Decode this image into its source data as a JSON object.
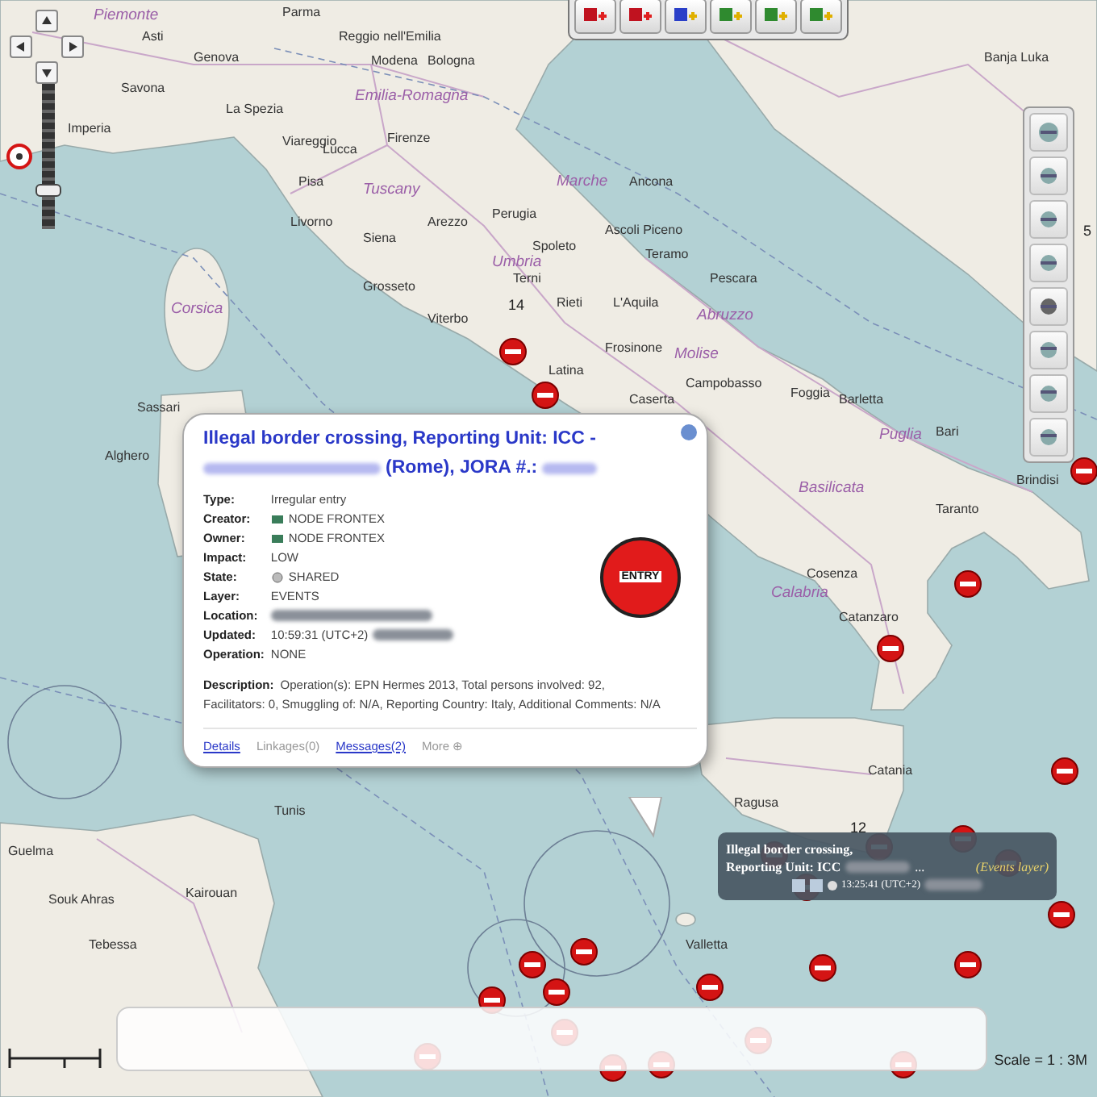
{
  "map": {
    "places": [
      {
        "name": "Piemonte",
        "kind": "region"
      },
      {
        "name": "Asti",
        "kind": "city"
      },
      {
        "name": "Savona",
        "kind": "city"
      },
      {
        "name": "Imperia",
        "kind": "city"
      },
      {
        "name": "Genova",
        "kind": "city"
      },
      {
        "name": "Parma",
        "kind": "city"
      },
      {
        "name": "Reggio nell'Emilia",
        "kind": "city"
      },
      {
        "name": "Modena",
        "kind": "city"
      },
      {
        "name": "Bologna",
        "kind": "city"
      },
      {
        "name": "Emilia-Romagna",
        "kind": "region"
      },
      {
        "name": "La Spezia",
        "kind": "city"
      },
      {
        "name": "Viareggio",
        "kind": "city"
      },
      {
        "name": "Lucca",
        "kind": "city"
      },
      {
        "name": "Firenze",
        "kind": "city"
      },
      {
        "name": "Pisa",
        "kind": "city"
      },
      {
        "name": "Livorno",
        "kind": "city"
      },
      {
        "name": "Tuscany",
        "kind": "region"
      },
      {
        "name": "Siena",
        "kind": "city"
      },
      {
        "name": "Arezzo",
        "kind": "city"
      },
      {
        "name": "Perugia",
        "kind": "city"
      },
      {
        "name": "Umbria",
        "kind": "region"
      },
      {
        "name": "Marche",
        "kind": "region"
      },
      {
        "name": "Ancona",
        "kind": "city"
      },
      {
        "name": "Grosseto",
        "kind": "city"
      },
      {
        "name": "Spoleto",
        "kind": "city"
      },
      {
        "name": "Ascoli Piceno",
        "kind": "city"
      },
      {
        "name": "Teramo",
        "kind": "city"
      },
      {
        "name": "Terni",
        "kind": "city"
      },
      {
        "name": "Viterbo",
        "kind": "city"
      },
      {
        "name": "Rieti",
        "kind": "city"
      },
      {
        "name": "L'Aquila",
        "kind": "city"
      },
      {
        "name": "Pescara",
        "kind": "city"
      },
      {
        "name": "Abruzzo",
        "kind": "region"
      },
      {
        "name": "Corsica",
        "kind": "region"
      },
      {
        "name": "Latina",
        "kind": "city"
      },
      {
        "name": "Frosinone",
        "kind": "city"
      },
      {
        "name": "Molise",
        "kind": "region"
      },
      {
        "name": "Campobasso",
        "kind": "city"
      },
      {
        "name": "Foggia",
        "kind": "city"
      },
      {
        "name": "Barletta",
        "kind": "city"
      },
      {
        "name": "Bari",
        "kind": "city"
      },
      {
        "name": "Puglia",
        "kind": "region"
      },
      {
        "name": "Caserta",
        "kind": "city"
      },
      {
        "name": "Taranto",
        "kind": "city"
      },
      {
        "name": "Brindisi",
        "kind": "city"
      },
      {
        "name": "Sassari",
        "kind": "city"
      },
      {
        "name": "Alghero",
        "kind": "city"
      },
      {
        "name": "Basilicata",
        "kind": "region"
      },
      {
        "name": "Cosenza",
        "kind": "city"
      },
      {
        "name": "Calabria",
        "kind": "region"
      },
      {
        "name": "Catanzaro",
        "kind": "city"
      },
      {
        "name": "Catania",
        "kind": "city"
      },
      {
        "name": "Ragusa",
        "kind": "city"
      },
      {
        "name": "Valletta",
        "kind": "city"
      },
      {
        "name": "Tunis",
        "kind": "city"
      },
      {
        "name": "Guelma",
        "kind": "city"
      },
      {
        "name": "Souk Ahras",
        "kind": "city"
      },
      {
        "name": "Kairouan",
        "kind": "city"
      },
      {
        "name": "Tebessa",
        "kind": "city"
      },
      {
        "name": "Banja Luka",
        "kind": "city"
      }
    ],
    "clusters": [
      {
        "count": "14"
      },
      {
        "count": "12"
      },
      {
        "count": "5"
      }
    ],
    "scale": "Scale = 1 : 3M"
  },
  "popup": {
    "title": [
      {
        "kind": "text",
        "text": "Illegal border crossing, Reporting Unit: ICC -"
      },
      {
        "kind": "redacted"
      },
      {
        "kind": "text",
        "text": "(Rome), JORA #.:"
      },
      {
        "kind": "redacted"
      }
    ],
    "fields": [
      {
        "label": "Type:",
        "kind": "text",
        "value": "Irregular entry"
      },
      {
        "label": "Creator:",
        "kind": "person",
        "value": "NODE FRONTEX"
      },
      {
        "label": "Owner:",
        "kind": "person",
        "value": "NODE FRONTEX"
      },
      {
        "label": "Impact:",
        "kind": "text",
        "value": "LOW"
      },
      {
        "label": "State:",
        "kind": "shared",
        "value": "SHARED"
      },
      {
        "label": "Layer:",
        "kind": "text",
        "value": "EVENTS"
      },
      {
        "label": "Location:",
        "kind": "redacted"
      },
      {
        "label": "Updated:",
        "kind": "text-redacted",
        "value": "10:59:31 (UTC+2)"
      },
      {
        "label": "Operation:",
        "kind": "text",
        "value": "NONE"
      }
    ],
    "badge": "ENTRY",
    "description_label": "Description:",
    "description": "Operation(s): EPN Hermes 2013, Total persons involved: 92, Facilitators: 0, Smuggling of: N/A, Reporting Country: Italy, Additional Comments: N/A",
    "links": [
      {
        "label": "Details",
        "disabled": false
      },
      {
        "label": "Linkages(0)",
        "disabled": true
      },
      {
        "label": "Messages(2)",
        "disabled": false
      },
      {
        "label": "More ⊕",
        "disabled": true
      }
    ]
  },
  "tooltip": {
    "line_1": "Illegal border crossing,",
    "line_2": "Reporting Unit: ICC",
    "ellipsis": "...",
    "layer": "(Events layer)",
    "time": "13:25:41 (UTC+2)"
  }
}
